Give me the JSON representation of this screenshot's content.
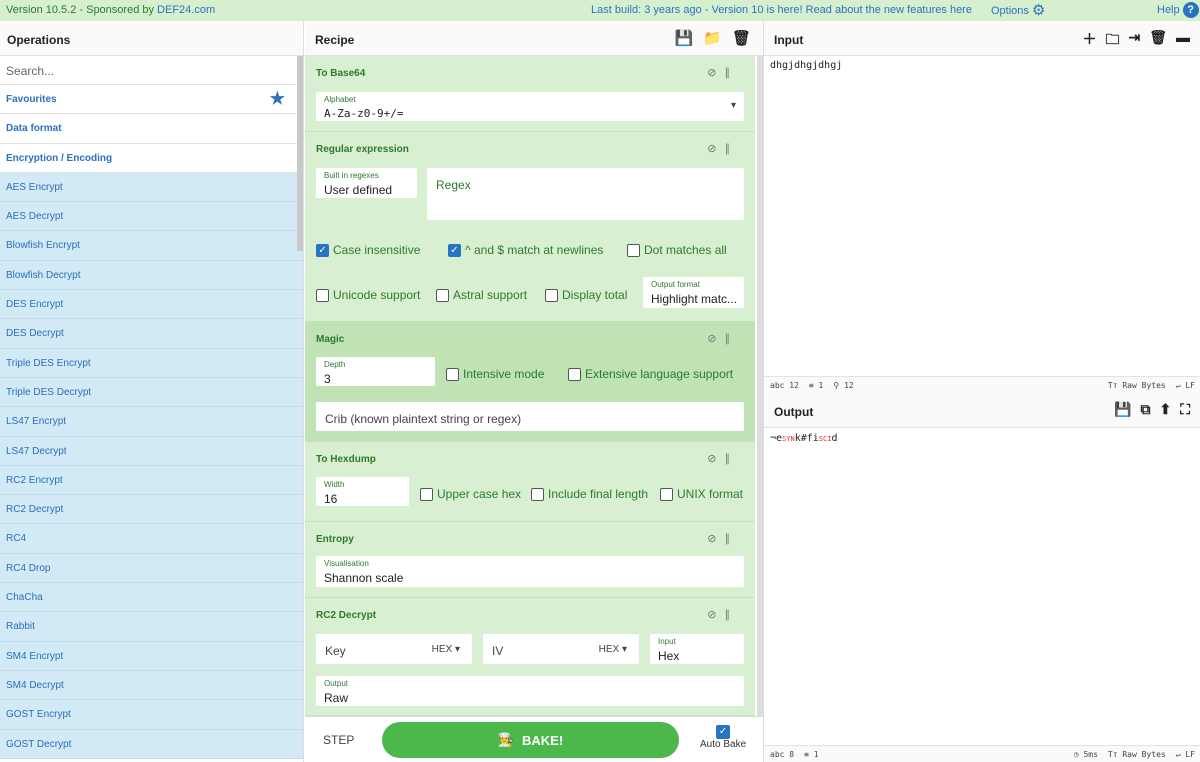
{
  "topbar": {
    "version": "Version 10.5.2 - Sponsored by ",
    "sponsor": "DEF24.com",
    "notice": "Last build: 3 years ago - Version 10 is here! Read about the new features here",
    "options": "Options",
    "help": "Help"
  },
  "operations": {
    "title": "Operations",
    "search_placeholder": "Search...",
    "categories": [
      "Favourites",
      "Data format",
      "Encryption / Encoding"
    ],
    "items": [
      "AES Encrypt",
      "AES Decrypt",
      "Blowfish Encrypt",
      "Blowfish Decrypt",
      "DES Encrypt",
      "DES Decrypt",
      "Triple DES Encrypt",
      "Triple DES Decrypt",
      "LS47 Encrypt",
      "LS47 Decrypt",
      "RC2 Encrypt",
      "RC2 Decrypt",
      "RC4",
      "RC4 Drop",
      "ChaCha",
      "Rabbit",
      "SM4 Encrypt",
      "SM4 Decrypt",
      "GOST Encrypt",
      "GOST Decrypt"
    ]
  },
  "recipe": {
    "title": "Recipe",
    "to_base64": {
      "title": "To Base64",
      "alphabet_label": "Alphabet",
      "alphabet_value": "A-Za-z0-9+/="
    },
    "regex": {
      "title": "Regular expression",
      "builtin_label": "Built in regexes",
      "builtin_value": "User defined",
      "regex_placeholder": "Regex",
      "case_insensitive": "Case insensitive",
      "multiline": "^ and $ match at newlines",
      "dot_all": "Dot matches all",
      "unicode": "Unicode support",
      "astral": "Astral support",
      "display_total": "Display total",
      "output_format_label": "Output format",
      "output_format_value": "Highlight matc..."
    },
    "magic": {
      "title": "Magic",
      "depth_label": "Depth",
      "depth_value": "3",
      "intensive": "Intensive mode",
      "extensive": "Extensive language support",
      "crib_placeholder": "Crib (known plaintext string or regex)"
    },
    "hexdump": {
      "title": "To Hexdump",
      "width_label": "Width",
      "width_value": "16",
      "upper": "Upper case hex",
      "final": "Include final length",
      "unix": "UNIX format"
    },
    "entropy": {
      "title": "Entropy",
      "vis_label": "Visualisation",
      "vis_value": "Shannon scale"
    },
    "rc2": {
      "title": "RC2 Decrypt",
      "key": "Key",
      "key_fmt": "HEX",
      "iv": "IV",
      "iv_fmt": "HEX",
      "input_label": "Input",
      "input_value": "Hex",
      "output_label": "Output",
      "output_value": "Raw"
    },
    "step": "STEP",
    "bake": "BAKE!",
    "auto_bake": "Auto Bake"
  },
  "input": {
    "title": "Input",
    "text": "dhgjdhgjdhgj",
    "chars": "12",
    "lines": "1",
    "pos": "12",
    "raw": "Raw Bytes",
    "eol": "LF"
  },
  "output": {
    "title": "Output",
    "text_a": "¬e",
    "text_b": "SYN",
    "text_c": "k#fi",
    "text_d": "SCI",
    "text_e": "d",
    "chars": "8",
    "lines": "1",
    "time": "5ms",
    "raw": "Raw Bytes",
    "eol": "LF"
  }
}
